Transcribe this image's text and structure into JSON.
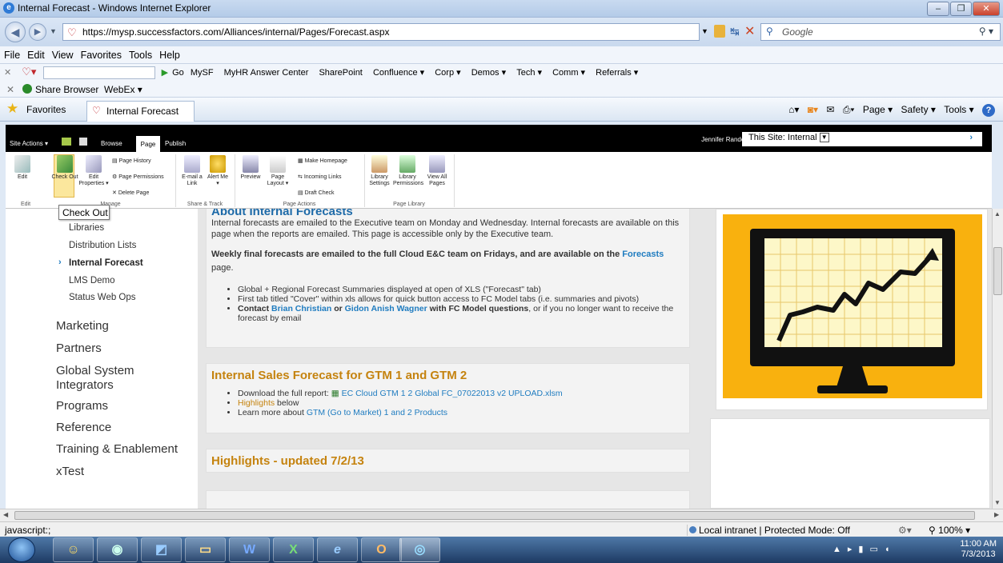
{
  "window": {
    "title": "Internal Forecast - Windows Internet Explorer"
  },
  "address": {
    "url": "https://mysp.successfactors.com/Alliances/internal/Pages/Forecast.aspx",
    "search_placeholder": "Google"
  },
  "menu": [
    "File",
    "Edit",
    "View",
    "Favorites",
    "Tools",
    "Help"
  ],
  "links_bar": {
    "go": "Go",
    "items": [
      "MySF",
      "MyHR Answer Center",
      "SharePoint",
      "Confluence ▾",
      "Corp ▾",
      "Demos ▾",
      "Tech ▾",
      "Comm ▾",
      "Referrals ▾"
    ]
  },
  "share_bar": {
    "items": [
      "Share Browser",
      "WebEx ▾"
    ]
  },
  "favorites": {
    "label": "Favorites",
    "tab": "Internal Forecast"
  },
  "command_bar": [
    "Page ▾",
    "Safety ▾",
    "Tools ▾"
  ],
  "sharepoint": {
    "site_actions": "Site Actions ▾",
    "tabs": [
      "Browse",
      "Page",
      "Publish"
    ],
    "user": "Jennifer Randolph",
    "site_search": "This Site: Internal",
    "ribbon": {
      "edit": "Edit",
      "check_out": "Check Out",
      "edit_properties": "Edit Properties ▾",
      "page_history": "Page History",
      "page_permissions": "Page Permissions",
      "delete_page": "Delete Page",
      "email_link": "E-mail a Link",
      "alert_me": "Alert Me ▾",
      "preview": "Preview",
      "page_layout": "Page Layout ▾",
      "make_homepage": "Make Homepage",
      "incoming_links": "Incoming Links",
      "draft_check": "Draft Check",
      "library_settings": "Library Settings",
      "library_permissions": "Library Permissions",
      "view_all_pages": "View All Pages",
      "groups": [
        "Edit",
        "Manage",
        "Share & Track",
        "Page Actions",
        "Page Library"
      ]
    },
    "tooltip": "Check Out"
  },
  "leftnav": {
    "sub_items": [
      "Libraries",
      "Distribution Lists",
      "Internal Forecast",
      "LMS Demo",
      "Status Web Ops"
    ],
    "main_items": [
      "Marketing",
      "Partners",
      "Global System Integrators",
      "Programs",
      "Reference",
      "Training & Enablement",
      "xTest"
    ]
  },
  "about": {
    "heading": "About Internal Forecasts",
    "p1": "Internal forecasts are emailed to the Executive team on Monday and Wednesday. Internal forecasts are available on this page when the reports are emailed. This page is accessible only by the Executive team.",
    "p2_bold": "Weekly final forecasts are emailed to the full Cloud E&C team on Fridays, and are available on the",
    "p2_link": "Forecasts",
    "p2_end": "page.",
    "b1": "Global + Regional Forecast Summaries displayed at open of XLS (\"Forecast\" tab)",
    "b2": "First tab titled \"Cover\" within xls allows for quick button access to FC Model tabs (i.e. summaries and pivots)",
    "b3_contact": "Contact",
    "b3_name1": "Brian Christian",
    "b3_or": "or",
    "b3_name2": "Gidon Anish Wagner",
    "b3_with": "with FC Model questions",
    "b3_end": ", or if you no longer want to receive the forecast by email"
  },
  "sales": {
    "heading": "Internal Sales Forecast for GTM 1 and GTM 2",
    "download": "Download the full report:",
    "file": "EC Cloud GTM 1 2 Global FC_07022013 v2 UPLOAD.xlsm",
    "highlights": "Highlights",
    "below": "below",
    "learn": "Learn more about",
    "learn_link": "GTM (Go to Market) 1 and 2 Products"
  },
  "highlights": {
    "heading": "Highlights - updated 7/2/13"
  },
  "status": {
    "left": "javascript:;",
    "zone": "Local intranet | Protected Mode: Off",
    "zoom": "100%"
  },
  "clock": {
    "time": "11:00 AM",
    "date": "7/3/2013"
  },
  "taskbar": [
    "W",
    "X",
    "O"
  ]
}
